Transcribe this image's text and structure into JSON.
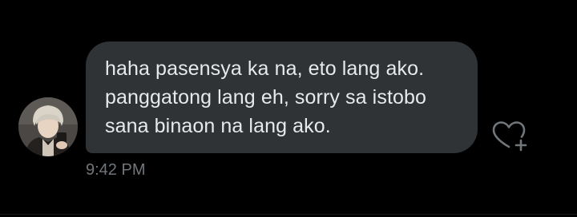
{
  "message": {
    "lines": [
      "haha pasensya ka na, eto lang ako.",
      "panggatong lang eh, sorry sa istobo",
      "sana binaon na lang ako."
    ],
    "timestamp": "9:42 PM"
  },
  "icons": {
    "like": "heart-plus-icon",
    "avatar": "user-avatar"
  },
  "colors": {
    "background": "#000000",
    "bubble": "#2f3336",
    "text": "#e7e9ea",
    "muted": "#71767b"
  }
}
